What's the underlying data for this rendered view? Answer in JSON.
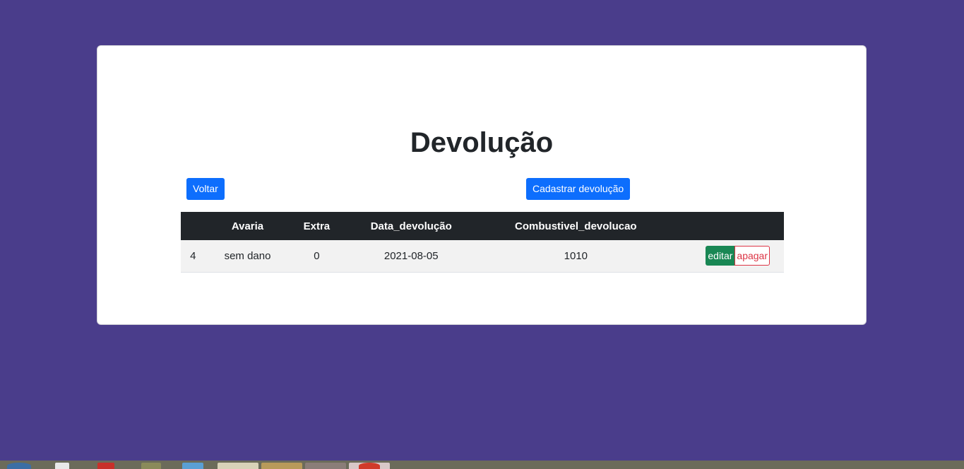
{
  "page": {
    "title": "Devolução"
  },
  "buttons": {
    "voltar": "Voltar",
    "cadastrar": "Cadastrar devolução"
  },
  "table": {
    "headers": [
      "",
      "Avaria",
      "Extra",
      "Data_devolução",
      "Combustivel_devolucao",
      ""
    ],
    "rows": [
      {
        "id": "4",
        "avaria": "sem dano",
        "extra": "0",
        "data_devolucao": "2021-08-05",
        "combustivel_devolucao": "1010",
        "edit_label": "editar",
        "delete_label": "apagar"
      }
    ]
  },
  "colors": {
    "background": "#4a3d8b",
    "primary": "#0d6efd",
    "success": "#198754",
    "danger": "#dc3545",
    "table_header": "#212529"
  }
}
